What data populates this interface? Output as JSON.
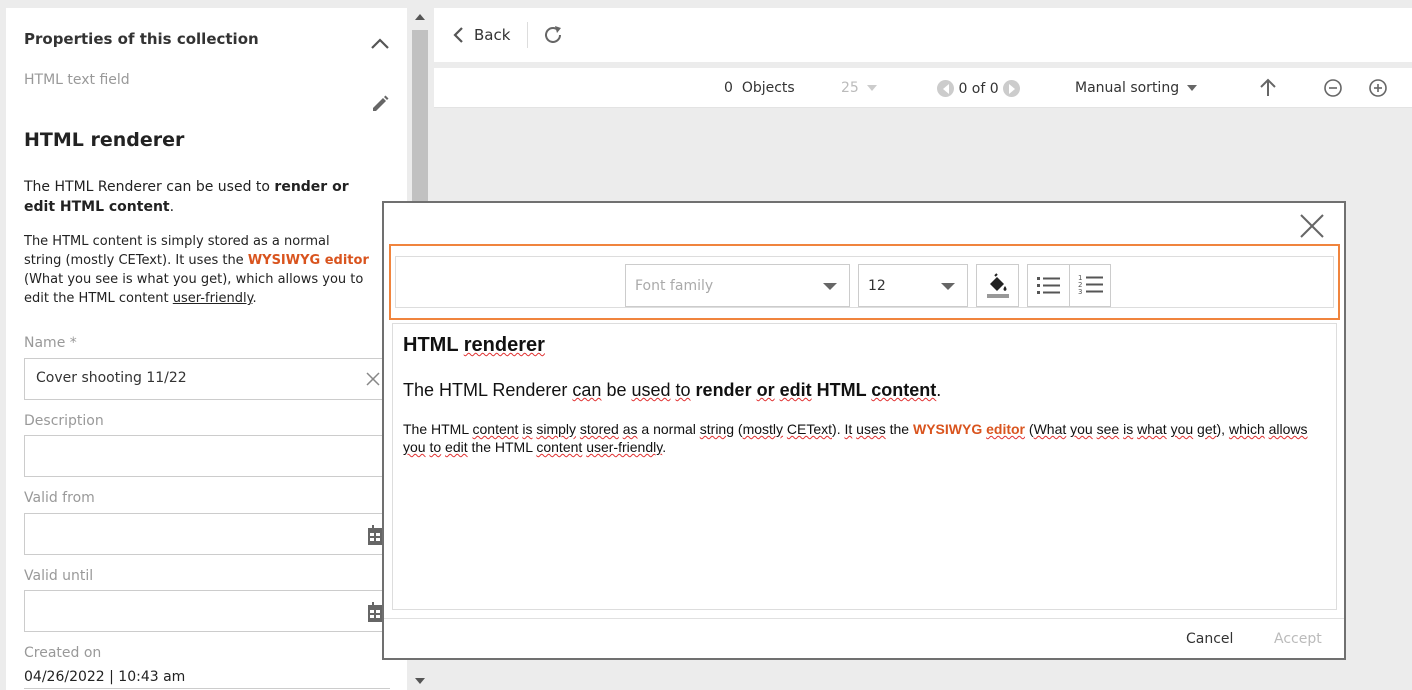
{
  "left_panel": {
    "title": "Properties of this collection",
    "subtitle": "HTML text field",
    "heading": "HTML renderer",
    "para1_pre": "The HTML Renderer can be used to ",
    "para1_bold": "render or edit HTML content",
    "para1_post": ".",
    "para2_pre": "The HTML content is simply stored as a normal string (mostly CEText). It uses the ",
    "para2_link": "WYSIWYG editor",
    "para2_mid": " (What you see is what you get), which allows you to edit the HTML content ",
    "para2_u": "user-friendly",
    "para2_post": ".",
    "fields": {
      "name_label": "Name *",
      "name_value": "Cover shooting 11/22",
      "description_label": "Description",
      "description_value": "",
      "valid_from_label": "Valid from",
      "valid_until_label": "Valid until",
      "created_on_label": "Created on",
      "created_on_value": "04/26/2022 | 10:43 am"
    }
  },
  "topbar": {
    "back_label": "Back"
  },
  "listbar": {
    "objects_count": "0",
    "objects_label": "Objects",
    "page_size": "25",
    "paging": "0 of 0",
    "sorting": "Manual sorting"
  },
  "modal": {
    "toolbar": {
      "font_family_placeholder": "Font family",
      "font_size": "12"
    },
    "editor": {
      "heading": "HTML renderer",
      "p1_pre": "The HTML Renderer ",
      "p1_sp1": "can",
      "p1_mid": " be ",
      "p1_sp2": "used",
      "p1_mid2": " ",
      "p1_sp3": "to",
      "p1_bold_pre": " render ",
      "p1_sp4": "or",
      "p1_bold_mid": " ",
      "p1_sp5": "edit",
      "p1_bold_post": " HTML ",
      "p1_sp6": "content",
      "p1_post": ".",
      "p2_pre": "The HTML ",
      "p2_sp1": "content",
      "p2_a": " ",
      "p2_sp2": "is",
      "p2_b": " ",
      "p2_sp3": "simply",
      "p2_c": " ",
      "p2_sp4": "stored",
      "p2_d": " ",
      "p2_sp5": "as",
      "p2_e": " a normal ",
      "p2_sp6": "string",
      "p2_f": " (",
      "p2_sp7": "mostly",
      "p2_g": " ",
      "p2_sp8": "CEText",
      "p2_h": "). ",
      "p2_sp9": "It",
      "p2_i": " ",
      "p2_sp10": "uses",
      "p2_j": " the ",
      "p2_link1": "WYSIWYG",
      "p2_k": " ",
      "p2_link2": "editor",
      "p2_l": " (",
      "p2_sp11": "What",
      "p2_m": " ",
      "p2_sp12": "you",
      "p2_n": " ",
      "p2_sp13": "see",
      "p2_o": " ",
      "p2_sp14": "is",
      "p2_p": " ",
      "p2_sp15": "what",
      "p2_q": " ",
      "p2_sp16": "you",
      "p2_r": " ",
      "p2_sp17": "get",
      "p2_s": "), ",
      "p2_sp18": "which",
      "p2_t": " ",
      "p2_sp19": "allows",
      "p2_u1": " ",
      "p2_sp20": "you",
      "p2_v": " ",
      "p2_sp21": "to",
      "p2_w": " ",
      "p2_sp22": "edit",
      "p2_x": " the HTML ",
      "p2_sp23": "content",
      "p2_y": " ",
      "p2_sp24": "user-friendly",
      "p2_z": "."
    },
    "cancel_label": "Cancel",
    "accept_label": "Accept"
  },
  "colors": {
    "accent_orange": "#d9541e",
    "highlight_border": "#f0843d"
  }
}
